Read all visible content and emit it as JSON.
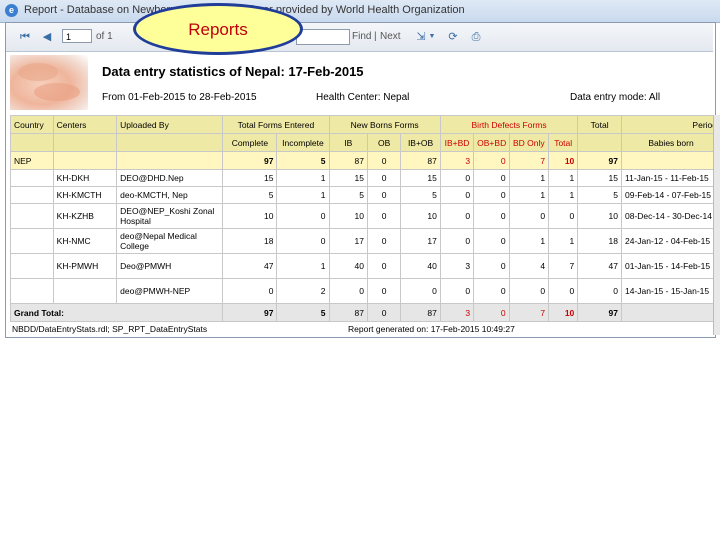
{
  "window": {
    "title": "Report - Database on Newborn ... Internet Explorer provided by World Health Organization"
  },
  "callout": {
    "label": "Reports"
  },
  "toolbar": {
    "first_icon": "first-page-icon",
    "prev_icon": "previous-page-icon",
    "page_value": "1",
    "of_label": "of 1",
    "find_label": "Find",
    "separator": "|",
    "next_label": "Next",
    "export_icon": "export-icon",
    "refresh_icon": "refresh-icon",
    "print_icon": "print-icon"
  },
  "report": {
    "title": "Data entry statistics of Nepal: 17-Feb-2015",
    "date_range": "From 01-Feb-2015 to 28-Feb-2015",
    "health_center": "Health Center: Nepal",
    "entry_mode": "Data entry mode: All"
  },
  "table": {
    "headers": {
      "country": "Country",
      "centers": "Centers",
      "uploaded_by": "Uploaded By",
      "total_forms": "Total Forms Entered",
      "newborn_forms": "New Borns Forms",
      "birth_defects": "Birth Defects Forms",
      "total": "Total",
      "period": "Period",
      "complete": "Complete",
      "incomplete": "Incomplete",
      "ib": "IB",
      "ob": "OB",
      "ib_ob": "IB+OB",
      "ib_bd": "IB+BD",
      "ob_bd": "OB+BD",
      "bd_only": "BD Only",
      "bd_total": "Total",
      "babies_born": "Babies born"
    },
    "nep_row": {
      "country": "NEP",
      "complete": "97",
      "incomplete": "5",
      "ib": "87",
      "ob": "0",
      "ib_ob": "87",
      "ib_bd": "3",
      "ob_bd": "0",
      "bd_only": "7",
      "bd_total": "10",
      "total": "97"
    },
    "rows": [
      {
        "center": "KH-DKH",
        "uploaded_by": "DEO@DHD.Nep",
        "complete": "15",
        "incomplete": "1",
        "ib": "15",
        "ob": "0",
        "ib_ob": "15",
        "ib_bd": "0",
        "ob_bd": "0",
        "bd_only": "1",
        "bd_total": "1",
        "total": "15",
        "period": "11-Jan-15 - 11-Feb-15"
      },
      {
        "center": "KH-KMCTH",
        "uploaded_by": "deo-KMCTH, Nep",
        "complete": "5",
        "incomplete": "1",
        "ib": "5",
        "ob": "0",
        "ib_ob": "5",
        "ib_bd": "0",
        "ob_bd": "0",
        "bd_only": "1",
        "bd_total": "1",
        "total": "5",
        "period": "09-Feb-14 - 07-Feb-15"
      },
      {
        "center": "KH-KZHB",
        "uploaded_by": "DEO@NEP_Koshi Zonal Hospital",
        "complete": "10",
        "incomplete": "0",
        "ib": "10",
        "ob": "0",
        "ib_ob": "10",
        "ib_bd": "0",
        "ob_bd": "0",
        "bd_only": "0",
        "bd_total": "0",
        "total": "10",
        "period": "08-Dec-14 - 30-Dec-14"
      },
      {
        "center": "KH-NMC",
        "uploaded_by": "deo@Nepal Medical College",
        "complete": "18",
        "incomplete": "0",
        "ib": "17",
        "ob": "0",
        "ib_ob": "17",
        "ib_bd": "0",
        "ob_bd": "0",
        "bd_only": "1",
        "bd_total": "1",
        "total": "18",
        "period": "24-Jan-12 - 04-Feb-15"
      },
      {
        "center": "KH-PMWH",
        "uploaded_by": "Deo@PMWH",
        "complete": "47",
        "incomplete": "1",
        "ib": "40",
        "ob": "0",
        "ib_ob": "40",
        "ib_bd": "3",
        "ob_bd": "0",
        "bd_only": "4",
        "bd_total": "7",
        "total": "47",
        "period": "01-Jan-15 - 14-Feb-15"
      },
      {
        "center": "",
        "uploaded_by": "deo@PMWH-NEP",
        "complete": "0",
        "incomplete": "2",
        "ib": "0",
        "ob": "0",
        "ib_ob": "0",
        "ib_bd": "0",
        "ob_bd": "0",
        "bd_only": "0",
        "bd_total": "0",
        "total": "0",
        "period": "14-Jan-15 - 15-Jan-15"
      }
    ],
    "grand_total": {
      "label": "Grand Total:",
      "complete": "97",
      "incomplete": "5",
      "ib": "87",
      "ob": "0",
      "ib_ob": "87",
      "ib_bd": "3",
      "ob_bd": "0",
      "bd_only": "7",
      "bd_total": "10",
      "total": "97"
    }
  },
  "footer": {
    "path": "NBDD/DataEntryStats.rdl; SP_RPT_DataEntryStats",
    "generated": "Report generated on: 17-Feb-2015 10:49:27"
  }
}
